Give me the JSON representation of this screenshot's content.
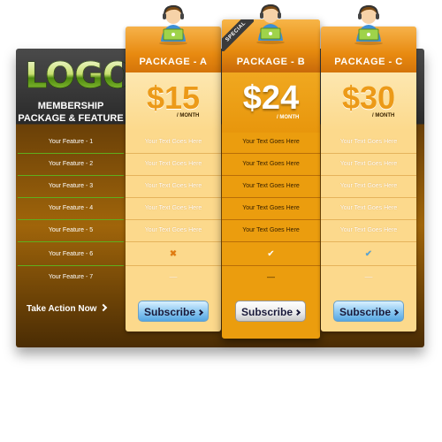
{
  "brand": {
    "logo_text": "LOGO",
    "subtitle_line1": "MEMBERSHIP",
    "subtitle_line2": "PACKAGE & FEATURE"
  },
  "features": [
    "Your Feature - 1",
    "Your Feature - 2",
    "Your Feature - 3",
    "Your Feature - 4",
    "Your Feature - 5",
    "Your Feature - 6",
    "Your Feature - 7"
  ],
  "take_action_label": "Take Action Now",
  "packages": [
    {
      "name": "PACKAGE - A",
      "price": "$15",
      "period": "/ MONTH",
      "cells": [
        "Your Text Goes Here",
        "Your Text Goes Here",
        "Your Text Goes Here",
        "Your Text Goes Here",
        "Your Text Goes Here"
      ],
      "feature6_icon": "cross-icon",
      "feature7_text": "—",
      "button_label": "Subscribe"
    },
    {
      "name": "PACKAGE - B",
      "badge": "SPECIAL",
      "price": "$24",
      "period": "/ MONTH",
      "cells": [
        "Your Text Goes Here",
        "Your Text Goes Here",
        "Your Text Goes Here",
        "Your Text Goes Here",
        "Your Text Goes Here"
      ],
      "feature6_icon": "check-icon",
      "feature7_text": "—",
      "button_label": "Subscribe"
    },
    {
      "name": "PACKAGE - C",
      "price": "$30",
      "period": "/ MONTH",
      "cells": [
        "Your Text Goes Here",
        "Your Text Goes Here",
        "Your Text Goes Here",
        "Your Text Goes Here",
        "Your Text Goes Here"
      ],
      "feature6_icon": "check-icon",
      "feature7_text": "—",
      "button_label": "Subscribe"
    }
  ],
  "glyphs": {
    "cross": "✖",
    "check": "✔"
  },
  "colors": {
    "accent_orange": "#e88a10",
    "featured_column": "#eb9d0e",
    "standard_column": "#fcd98c",
    "row_separator": "#5fae1d",
    "button_blue": "#56a6e2"
  }
}
